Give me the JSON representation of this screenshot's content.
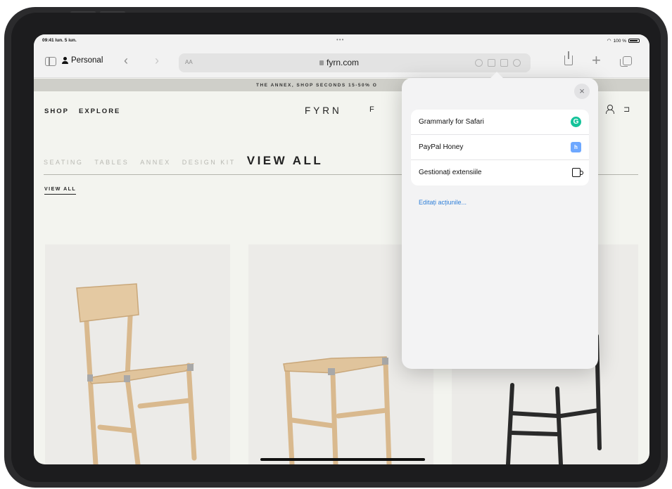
{
  "status_bar": {
    "time": "09:41 lun. 5 iun.",
    "battery": "100 %"
  },
  "toolbar": {
    "profile_label": "Personal",
    "text_size_label": "AA",
    "url": "fyrn.com"
  },
  "site": {
    "promo": "THE ANNEX, SHOP SECONDS 15-50% O",
    "nav": {
      "shop": "SHOP",
      "explore": "EXPLORE"
    },
    "logo": "FYRN",
    "flag": "F",
    "cart": "ʮ",
    "categories": [
      "SEATING",
      "TABLES",
      "ANNEX",
      "DESIGN KIT"
    ],
    "active_category": "VIEW ALL",
    "sub_link": "VIEW ALL"
  },
  "extensions_popover": {
    "close_label": "×",
    "items": [
      {
        "label": "Grammarly for Safari",
        "icon": "grammarly-icon",
        "icon_text": "G"
      },
      {
        "label": "PayPal Honey",
        "icon": "honey-icon",
        "icon_text": "h"
      },
      {
        "label": "Gestionați extensiile",
        "icon": "manage-extensions-icon"
      }
    ],
    "edit_actions": "Editați acțiunile..."
  }
}
